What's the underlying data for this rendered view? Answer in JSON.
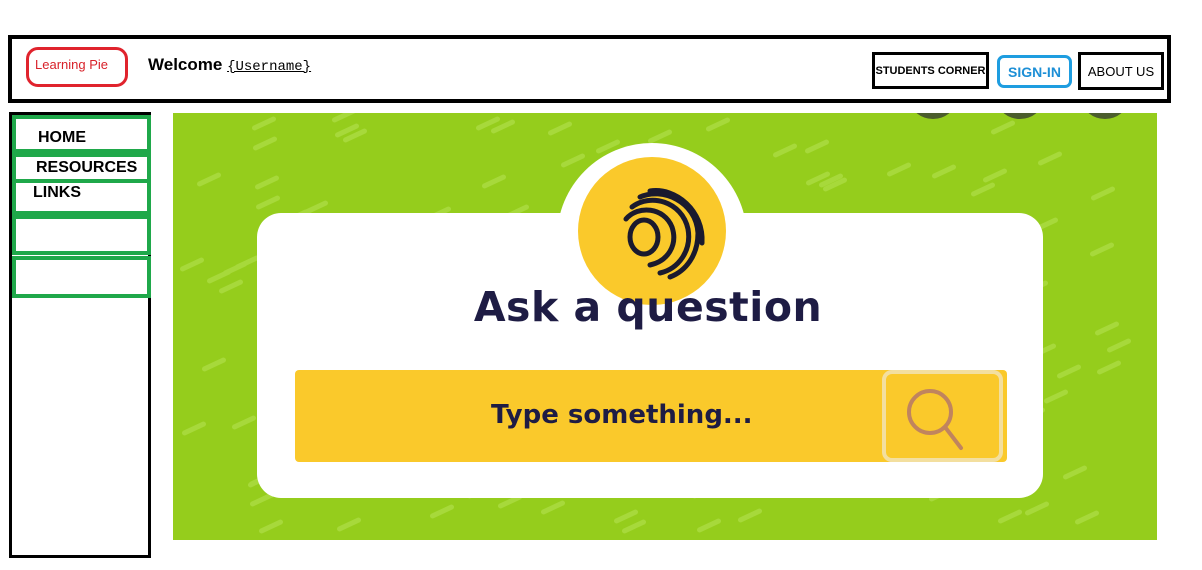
{
  "header": {
    "logo_text": "Learning Pie",
    "welcome_label": "Welcome",
    "username": "{Username}",
    "nav": {
      "students_corner": "STUDENTS CORNER",
      "sign_in": "SIGN-IN",
      "about_us": "ABOUT US"
    }
  },
  "sidebar": {
    "items": [
      {
        "label": "HOME"
      },
      {
        "label": "RESOURCES"
      },
      {
        "label": "LINKS"
      },
      {
        "label": ""
      },
      {
        "label": ""
      }
    ]
  },
  "hero": {
    "title": "Ask a question",
    "search_placeholder": "Type something...",
    "icons": {
      "logo": "spiral-logo-icon",
      "search": "search-icon"
    },
    "colors": {
      "background": "#95cd1c",
      "accent": "#fac92b",
      "text": "#1e1c44"
    }
  },
  "colors": {
    "logo_border": "#e0232d",
    "signin": "#1e9de0",
    "nav_border": "#1fa84a"
  }
}
